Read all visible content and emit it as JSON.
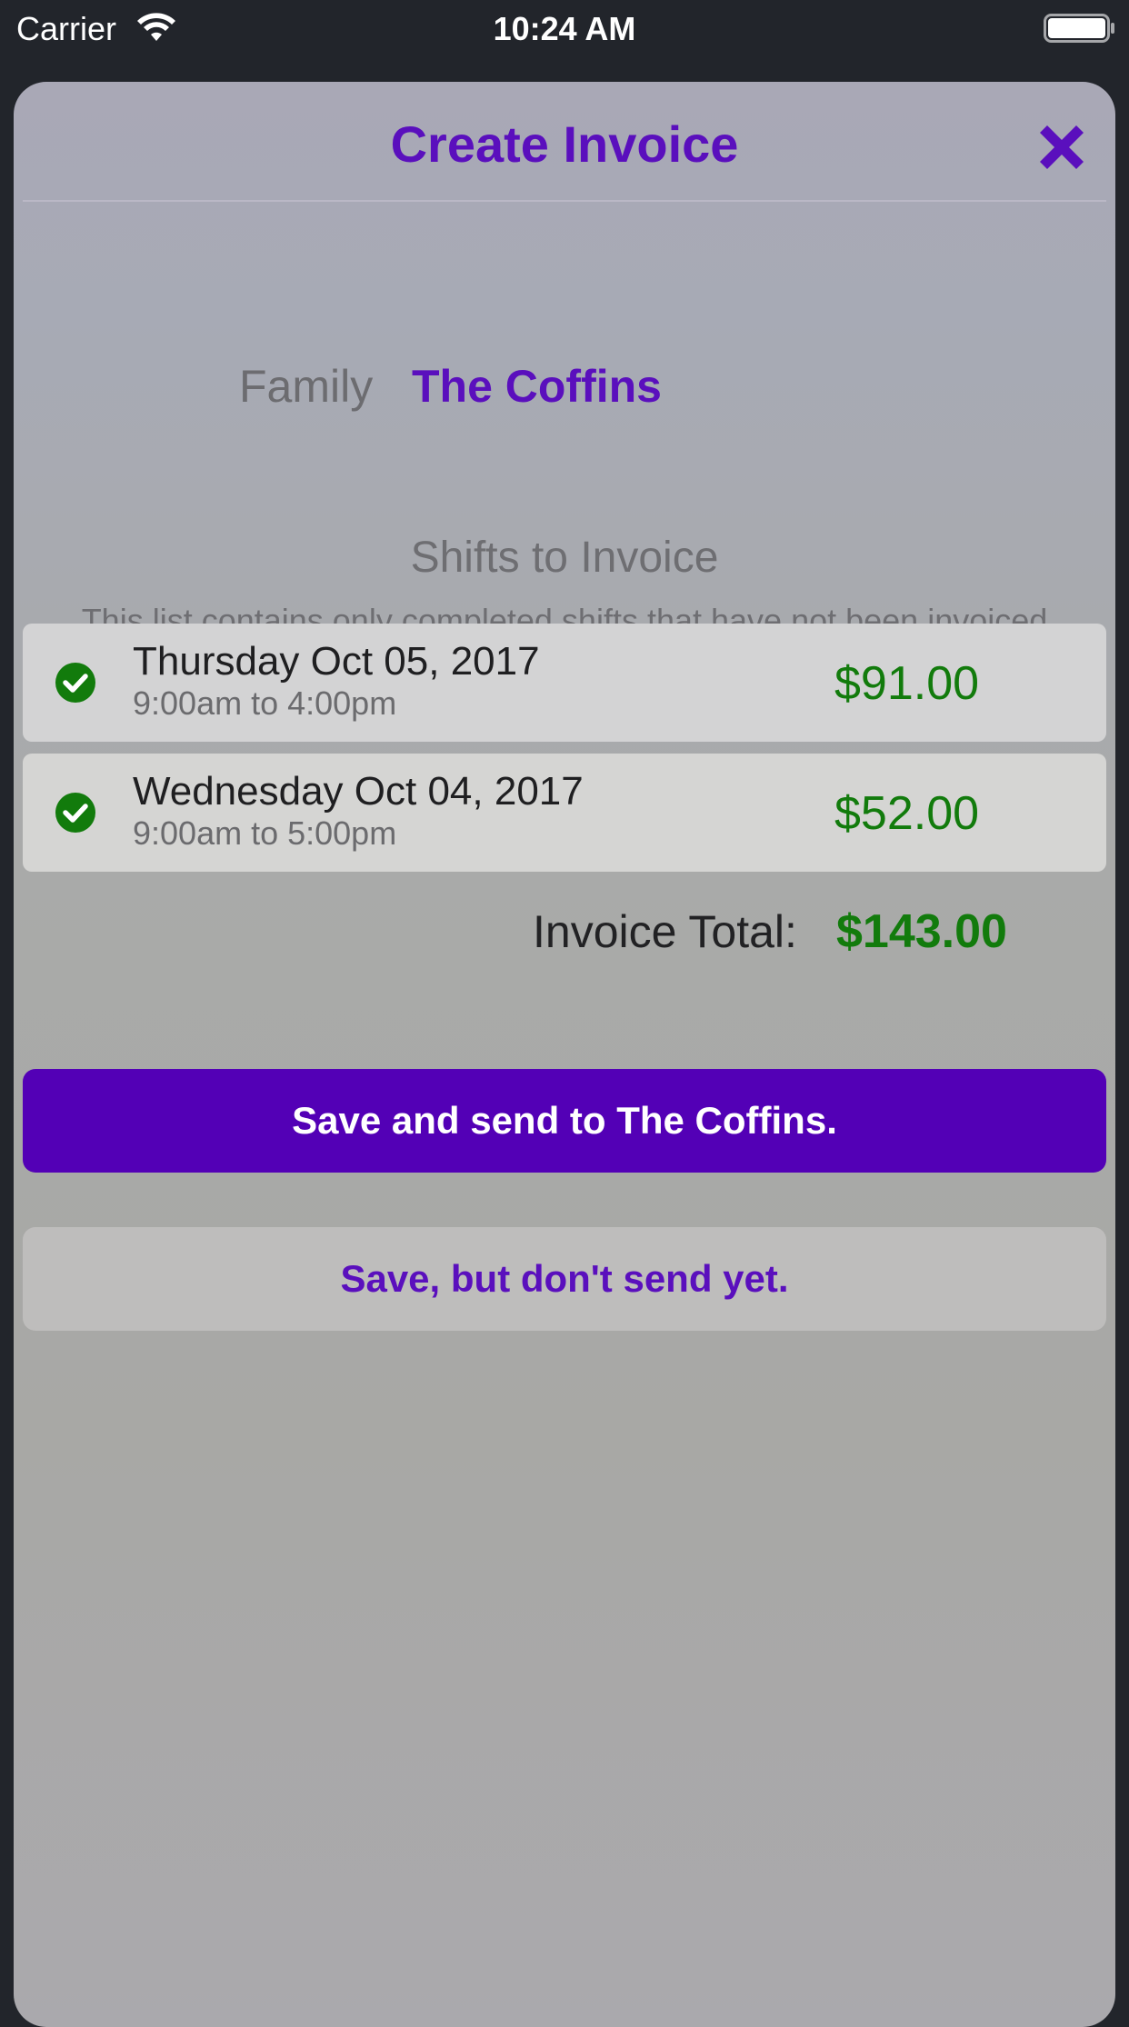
{
  "status_bar": {
    "carrier": "Carrier",
    "time": "10:24 AM",
    "wifi_icon": "wifi-icon",
    "battery_icon": "battery-icon"
  },
  "modal": {
    "title": "Create Invoice",
    "close_icon": "close-icon",
    "family": {
      "label": "Family",
      "value": "The Coffins"
    },
    "shifts": {
      "title": "Shifts to Invoice",
      "description": "This list contains only completed shifts that have not been invoiced for the selected family.",
      "items": [
        {
          "date": "Thursday Oct 05, 2017",
          "time": "9:00am to 4:00pm",
          "amount": "$91.00",
          "selected": true
        },
        {
          "date": "Wednesday Oct 04, 2017",
          "time": "9:00am to 5:00pm",
          "amount": "$52.00",
          "selected": true
        }
      ]
    },
    "total": {
      "label": "Invoice Total:",
      "value": "$143.00"
    },
    "buttons": {
      "save_and_send": "Save and send to The Coffins.",
      "save_only": "Save, but don't send yet."
    }
  },
  "colors": {
    "brand_purple": "#5a0fbd",
    "button_purple": "#5300b6",
    "money_green": "#127b0c"
  }
}
